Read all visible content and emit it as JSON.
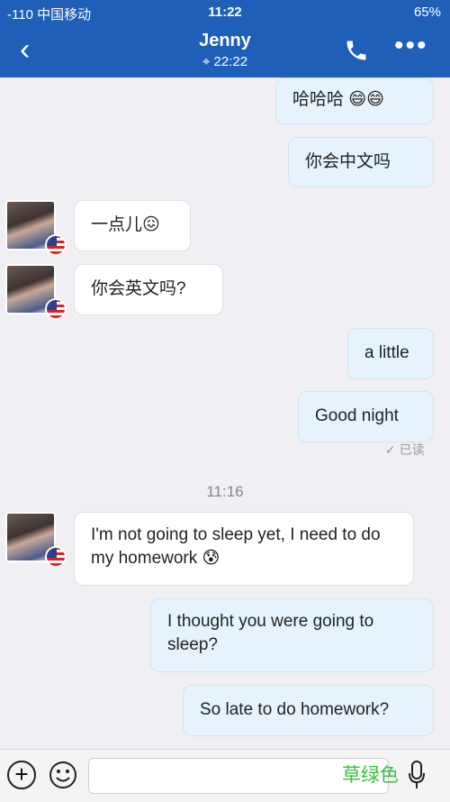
{
  "status_bar": {
    "left": "-110 中国移动",
    "time": "11:22",
    "battery": "65%"
  },
  "header": {
    "title": "Jenny",
    "location_time": "22:22"
  },
  "messages": [
    {
      "dir": "out",
      "text": "哈哈哈 😄😄"
    },
    {
      "dir": "out",
      "text": "你会中文吗"
    },
    {
      "dir": "in",
      "text": "一点儿😖"
    },
    {
      "dir": "in",
      "text": "你会英文吗?"
    },
    {
      "dir": "out",
      "text": "a little"
    },
    {
      "dir": "out",
      "text": "Good night"
    },
    {
      "dir": "in",
      "text": "I'm not going to sleep yet, I need to do my homework 😰"
    },
    {
      "dir": "out",
      "text": "I thought you were going to sleep?"
    },
    {
      "dir": "out",
      "text": "So late to do homework?"
    }
  ],
  "read_receipt": "✓ 已读",
  "timestamp": "11:16",
  "watermark": "草绿色",
  "colors": {
    "brand": "#1f5fb8",
    "outgoing_bubble": "#e6f3fd",
    "incoming_bubble": "#ffffff"
  }
}
